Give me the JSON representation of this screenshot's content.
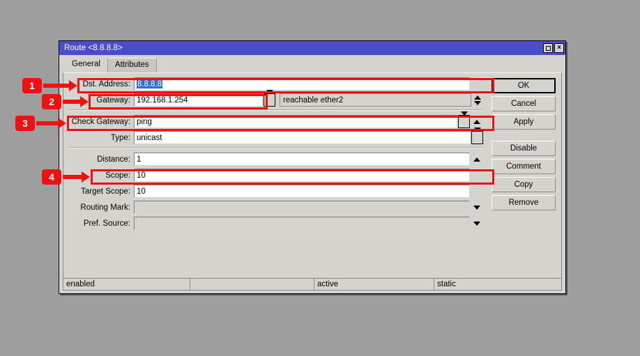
{
  "window": {
    "title": "Route <8.8.8.8>",
    "buttons": {
      "restore": "restore-icon",
      "close": "×"
    }
  },
  "tabs": [
    {
      "label": "General",
      "active": true
    },
    {
      "label": "Attributes",
      "active": false
    }
  ],
  "form": {
    "dst_address": {
      "label": "Dst. Address:",
      "value": "8.8.8.8",
      "selected": true
    },
    "gateway": {
      "label": "Gateway:",
      "value": "192.168.1.254",
      "status": "reachable ether2"
    },
    "check_gateway": {
      "label": "Check Gateway:",
      "value": "ping"
    },
    "type": {
      "label": "Type:",
      "value": "unicast"
    },
    "distance": {
      "label": "Distance:",
      "value": "1"
    },
    "scope": {
      "label": "Scope:",
      "value": "10"
    },
    "target_scope": {
      "label": "Target Scope:",
      "value": "10"
    },
    "routing_mark": {
      "label": "Routing Mark:",
      "value": ""
    },
    "pref_source": {
      "label": "Pref. Source:",
      "value": ""
    }
  },
  "buttons": {
    "ok": "OK",
    "cancel": "Cancel",
    "apply": "Apply",
    "disable": "Disable",
    "comment": "Comment",
    "copy": "Copy",
    "remove": "Remove"
  },
  "statusbar": {
    "cell1": "enabled",
    "cell2": "",
    "cell3": "active",
    "cell4": "static"
  },
  "annotations": {
    "accent_color": "#ee1111",
    "callouts": [
      {
        "number": "1",
        "target": "dst-address-row"
      },
      {
        "number": "2",
        "target": "gateway-row"
      },
      {
        "number": "3",
        "target": "check-gateway-row"
      },
      {
        "number": "4",
        "target": "scope-row"
      }
    ]
  },
  "colors": {
    "titlebar": "#4a4ec8",
    "desktop": "#9e9e9e",
    "dialog": "#d6d3ce",
    "selection": "#2a6fd6"
  }
}
